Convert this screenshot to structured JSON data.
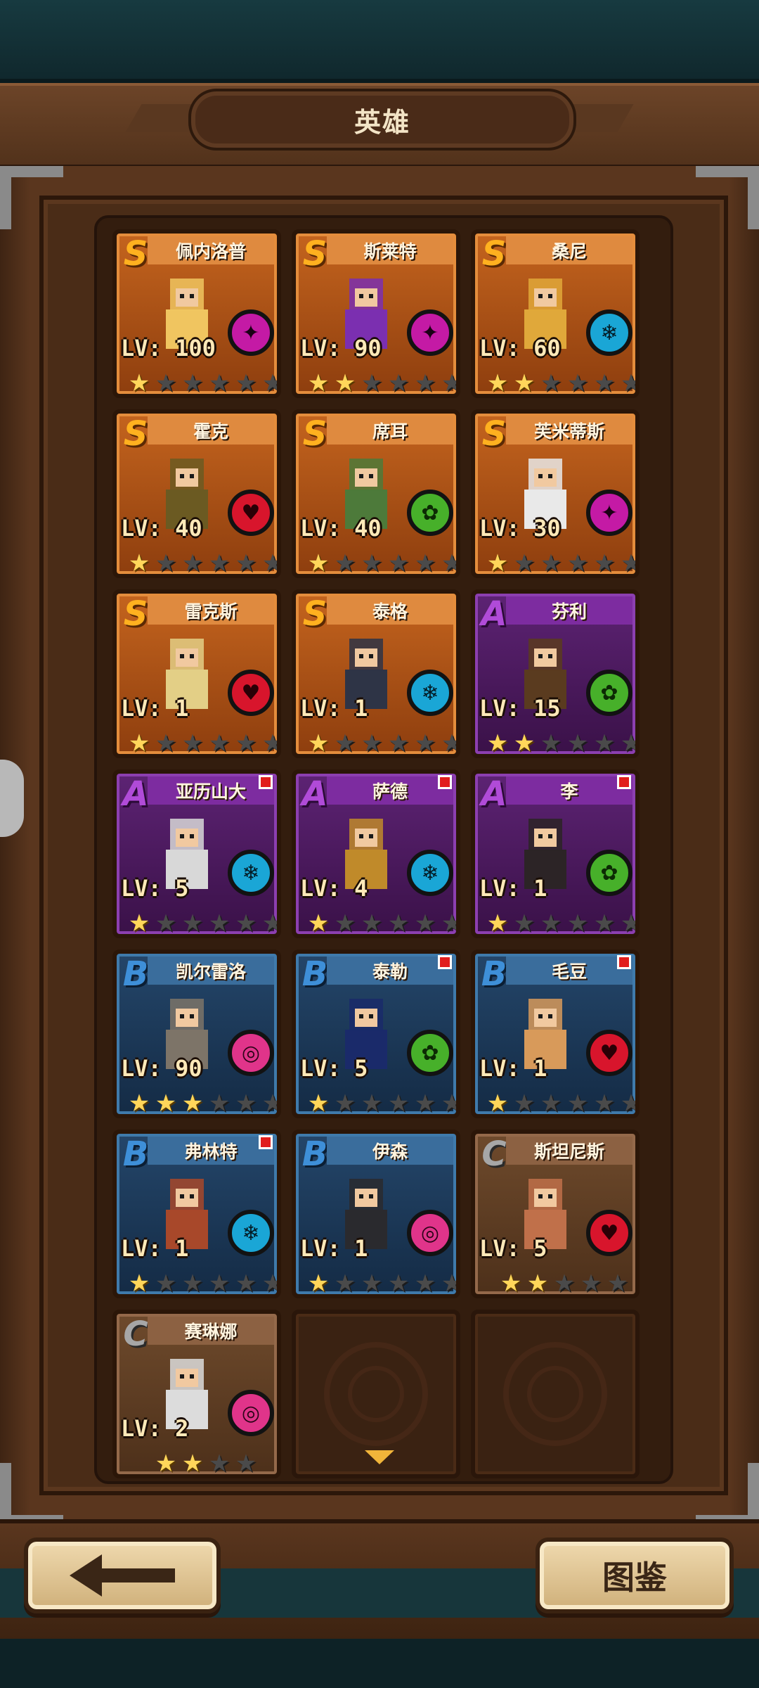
{
  "header": {
    "title": "英雄"
  },
  "heroes": [
    {
      "name": "佩内洛普",
      "rank": "S",
      "level": "LV: 100",
      "element": "magic",
      "stars": 1,
      "max_stars": 6,
      "new": false,
      "portrait_color": "#f0c560"
    },
    {
      "name": "斯莱特",
      "rank": "S",
      "level": "LV: 90",
      "element": "magic",
      "stars": 2,
      "max_stars": 6,
      "new": false,
      "portrait_color": "#7b2fb0"
    },
    {
      "name": "桑尼",
      "rank": "S",
      "level": "LV: 60",
      "element": "ice",
      "stars": 2,
      "max_stars": 6,
      "new": false,
      "portrait_color": "#e0a83a"
    },
    {
      "name": "霍克",
      "rank": "S",
      "level": "LV: 40",
      "element": "heart",
      "stars": 1,
      "max_stars": 6,
      "new": false,
      "portrait_color": "#6b5a22"
    },
    {
      "name": "席耳",
      "rank": "S",
      "level": "LV: 40",
      "element": "nature",
      "stars": 1,
      "max_stars": 6,
      "new": false,
      "portrait_color": "#4d7a3a"
    },
    {
      "name": "芙米蒂斯",
      "rank": "S",
      "level": "LV: 30",
      "element": "magic",
      "stars": 1,
      "max_stars": 6,
      "new": false,
      "portrait_color": "#e9e9e9"
    },
    {
      "name": "雷克斯",
      "rank": "S",
      "level": "LV: 1",
      "element": "heart",
      "stars": 1,
      "max_stars": 6,
      "new": false,
      "portrait_color": "#e3cf86"
    },
    {
      "name": "泰格",
      "rank": "S",
      "level": "LV: 1",
      "element": "ice",
      "stars": 1,
      "max_stars": 6,
      "new": false,
      "portrait_color": "#2e3446"
    },
    {
      "name": "芬利",
      "rank": "A",
      "level": "LV: 15",
      "element": "nature",
      "stars": 2,
      "max_stars": 6,
      "new": false,
      "portrait_color": "#5a3b1f"
    },
    {
      "name": "亚历山大",
      "rank": "A",
      "level": "LV: 5",
      "element": "ice",
      "stars": 1,
      "max_stars": 6,
      "new": true,
      "portrait_color": "#d8d8d8"
    },
    {
      "name": "萨德",
      "rank": "A",
      "level": "LV: 4",
      "element": "ice",
      "stars": 1,
      "max_stars": 6,
      "new": true,
      "portrait_color": "#c08a2a"
    },
    {
      "name": "李",
      "rank": "A",
      "level": "LV: 1",
      "element": "nature",
      "stars": 1,
      "max_stars": 6,
      "new": true,
      "portrait_color": "#2c2426"
    },
    {
      "name": "凯尔雷洛",
      "rank": "B",
      "level": "LV: 90",
      "element": "spiral",
      "stars": 3,
      "max_stars": 6,
      "new": false,
      "portrait_color": "#7d7468"
    },
    {
      "name": "泰勒",
      "rank": "B",
      "level": "LV: 5",
      "element": "nature",
      "stars": 1,
      "max_stars": 6,
      "new": true,
      "portrait_color": "#1a2a6a"
    },
    {
      "name": "毛豆",
      "rank": "B",
      "level": "LV: 1",
      "element": "heart",
      "stars": 1,
      "max_stars": 6,
      "new": true,
      "portrait_color": "#d89a5a"
    },
    {
      "name": "弗林特",
      "rank": "B",
      "level": "LV: 1",
      "element": "ice",
      "stars": 1,
      "max_stars": 6,
      "new": true,
      "portrait_color": "#a8482a"
    },
    {
      "name": "伊森",
      "rank": "B",
      "level": "LV: 1",
      "element": "spiral",
      "stars": 1,
      "max_stars": 6,
      "new": false,
      "portrait_color": "#2a2a2e"
    },
    {
      "name": "斯坦尼斯",
      "rank": "C",
      "level": "LV: 5",
      "element": "heart",
      "stars": 2,
      "max_stars": 5,
      "new": false,
      "portrait_color": "#c0704a"
    },
    {
      "name": "赛琳娜",
      "rank": "C",
      "level": "LV: 2",
      "element": "spiral",
      "stars": 2,
      "max_stars": 4,
      "new": false,
      "portrait_color": "#dcdcdc"
    }
  ],
  "empty_slots": 2,
  "buttons": {
    "back_icon": "arrow-left-icon",
    "dex_label": "图鉴"
  },
  "colors": {
    "accent": "#f1b53a",
    "new_badge": "#e11d1d"
  }
}
